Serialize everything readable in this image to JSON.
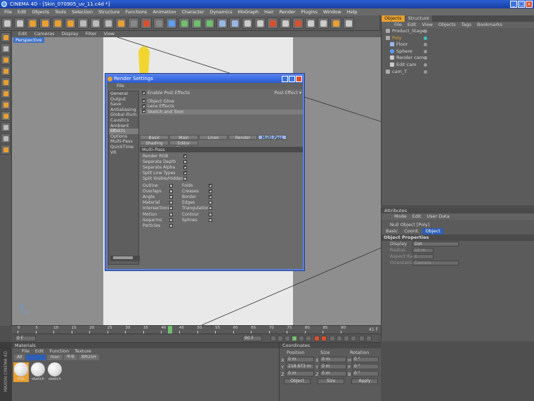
{
  "app": {
    "title": "CINEMA 4D - [Skin_070905_uv_11.c4d *]"
  },
  "menu": [
    "File",
    "Edit",
    "Objects",
    "Tools",
    "Selection",
    "Structure",
    "Functions",
    "Animation",
    "Character",
    "Dynamics",
    "MoGraph",
    "Hair",
    "Render",
    "Plugins",
    "Window",
    "Help"
  ],
  "viewport": {
    "menu": [
      "Edit",
      "Cameras",
      "Display",
      "Filter",
      "View"
    ],
    "label": "Perspective"
  },
  "object_manager": {
    "tabs": [
      "Objects",
      "Structure"
    ],
    "menu": [
      "File",
      "Edit",
      "View",
      "Objects",
      "Tags",
      "Bookmarks"
    ],
    "items": [
      {
        "name": "Product_Stage"
      },
      {
        "name": "Poly"
      },
      {
        "name": "Floor"
      },
      {
        "name": "Sphere"
      },
      {
        "name": "Render cam"
      },
      {
        "name": "Edit cam"
      },
      {
        "name": "cam_T"
      }
    ]
  },
  "attributes": {
    "header": "Attributes",
    "menu": [
      "Mode",
      "Edit",
      "User Data"
    ],
    "object_name": "Null Object [Poly]",
    "tabs": [
      "Basic",
      "Coord.",
      "Object"
    ],
    "section": "Object Properties",
    "fields": [
      {
        "label": "Display",
        "value": "Dot"
      },
      {
        "label": "Radius",
        "value": "10 m"
      },
      {
        "label": "Aspect Ratio",
        "value": "1"
      },
      {
        "label": "Orientation",
        "value": "Camera"
      }
    ]
  },
  "timeline": {
    "ticks": [
      "0",
      "5",
      "10",
      "15",
      "20",
      "25",
      "30",
      "35",
      "40",
      "45",
      "50",
      "55",
      "60",
      "65",
      "70",
      "75",
      "80",
      "85",
      "90"
    ],
    "current": "41 F",
    "start": "0 F",
    "end": "90 F"
  },
  "materials": {
    "header": "Materials",
    "menu": [
      "File",
      "Edit",
      "Function",
      "Texture"
    ],
    "filters": [
      "All",
      "man",
      "목재",
      "BRUSH"
    ],
    "items": [
      "Mat",
      "sketch",
      "sketch"
    ]
  },
  "coordinates": {
    "header": "Coordinates",
    "columns": [
      "Position",
      "Size",
      "Rotation"
    ],
    "rows": [
      {
        "axis": "X",
        "pos": "0 m",
        "size": "0 m",
        "rl": "H",
        "rot": "0 °"
      },
      {
        "axis": "Y",
        "pos": "218.673 m",
        "size": "0 m",
        "rl": "P",
        "rot": "0 °"
      },
      {
        "axis": "Z",
        "pos": "0 m",
        "size": "0 m",
        "rl": "B",
        "rot": "0 °"
      }
    ],
    "mode": "Object",
    "sizemode": "Size",
    "apply": "Apply"
  },
  "brand": "MAXON CINEMA 4D",
  "render_settings": {
    "title": "Render Settings",
    "menu": "File",
    "categories": [
      "General",
      "Output",
      "Save",
      "Antialiasing",
      "Global Illum.",
      "Caustics",
      "Ambient Occl.",
      "Effects",
      "Options",
      "Multi-Pass",
      "QuickTime VR"
    ],
    "enable_label": "Enable Post Effects",
    "post_effect_label": "Post Effect",
    "effects": [
      "Object Glow",
      "Lens Effects",
      "Sketch and Toon"
    ],
    "tabs": [
      "Basic",
      "Main",
      "Lines",
      "Render",
      "Multi-Pass"
    ],
    "tabs2": [
      "Shading",
      "Editor Display"
    ],
    "section": "Multi-Pass",
    "options_top": [
      {
        "label": "Render RGB",
        "on": true
      },
      {
        "label": "Separate Depth",
        "on": false
      },
      {
        "label": "Separate Alpha",
        "on": true
      },
      {
        "label": "Split Line Types",
        "on": true
      },
      {
        "label": "Split Visible/Hidden",
        "on": false
      }
    ],
    "options_left": [
      {
        "label": "Outline",
        "on": false
      },
      {
        "label": "Overlaps",
        "on": false
      },
      {
        "label": "Angle",
        "on": false
      },
      {
        "label": "Material",
        "on": false
      },
      {
        "label": "Intersections",
        "on": false
      },
      {
        "label": "Motion",
        "on": false
      },
      {
        "label": "Isoparms",
        "on": false
      },
      {
        "label": "Particles",
        "on": false
      }
    ],
    "options_right": [
      {
        "label": "Folds",
        "on": true
      },
      {
        "label": "Creases",
        "on": true
      },
      {
        "label": "Border",
        "on": true
      },
      {
        "label": "Edges",
        "on": false
      },
      {
        "label": "Triangulation",
        "on": false
      },
      {
        "label": "Contour",
        "on": false
      },
      {
        "label": "Splines",
        "on": false
      }
    ]
  }
}
